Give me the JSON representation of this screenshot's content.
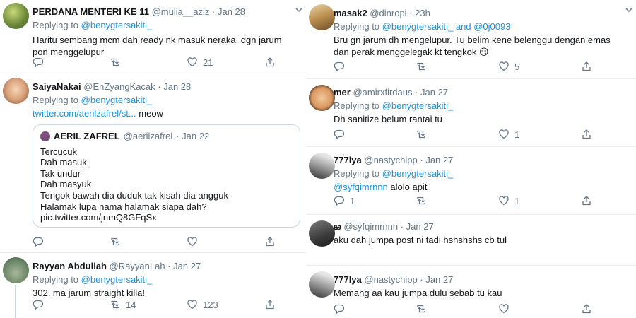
{
  "left": {
    "tweets": [
      {
        "name": "PERDANA MENTERI KE 11",
        "handle": "@mulia__aziz",
        "date": "· Jan 28",
        "replying_prefix": "Replying to ",
        "replying_to": "@benygtersakiti_",
        "text": "Haritu sembang mcm dah ready nk masuk neraka, dgn jarum pon menggelupur",
        "reply_count": "",
        "retweet_count": "",
        "like_count": "21"
      },
      {
        "name": "SaiyaNakai",
        "handle": "@EnZyangKacak",
        "date": "· Jan 28",
        "replying_prefix": "Replying to ",
        "replying_to": "@benygtersakiti_",
        "link": "twitter.com/aerilzafrel/st...",
        "text_after_link": " meow",
        "quote": {
          "name": "AERIL ZAFREL",
          "handle": "@aerilzafrel",
          "date": "· Jan 22",
          "lines": [
            "Tercucuk",
            "Dah masuk",
            "Tak undur",
            "Dah masyuk",
            "Tengok bawah dia duduk tak kisah dia angguk",
            "Halamak lupa nama halamak siapa dah?",
            "pic.twitter.com/jnmQ8GFqSx"
          ]
        }
      },
      {
        "name": "Rayyan Abdullah",
        "handle": "@RayyanLah",
        "date": "· Jan 27",
        "replying_prefix": "Replying to ",
        "replying_to": "@benygtersakiti_",
        "text": "302, ma jarum straight killa!",
        "reply_count": "",
        "retweet_count": "14",
        "like_count": "123"
      }
    ]
  },
  "right": {
    "tweets": [
      {
        "name": "masak2",
        "handle": "@dinropi",
        "date": "· 23h",
        "replying_prefix": "Replying to ",
        "replying_to": "@benygtersakiti_ and @0j0093",
        "text": "Bru gn jarum dh mengelupur. Tu belim kene belenggu dengan emas dan perak menggelegak kt tengkok 😏",
        "reply_count": "",
        "retweet_count": "",
        "like_count": "5"
      },
      {
        "name": "mer",
        "handle": "@amirxfirdaus",
        "date": "· Jan 27",
        "replying_prefix": "Replying to ",
        "replying_to": "@benygtersakiti_",
        "text": "Dh sanitize belum rantai tu",
        "reply_count": "",
        "retweet_count": "",
        "like_count": "1"
      },
      {
        "name": "777lya",
        "handle": "@nastychipp",
        "date": "· Jan 27",
        "replying_prefix": "Replying to ",
        "replying_to": "@benygtersakiti_",
        "mention": "@syfqimrnnn",
        "text_after_mention": " alolo apit",
        "reply_count": "1",
        "retweet_count": "",
        "like_count": "1"
      },
      {
        "name": "ఱ",
        "handle": "@syfqimrnnn",
        "date": "· Jan 27",
        "text": "aku dah jumpa post ni tadi hshshshs cb tul"
      },
      {
        "name": "777lya",
        "handle": "@nastychipp",
        "date": "· Jan 27",
        "text": "Memang aa kau jumpa dulu sebab tu kau"
      }
    ]
  },
  "icons": {
    "reply": "reply-icon",
    "retweet": "retweet-icon",
    "like": "like-icon",
    "share": "share-icon",
    "chevron": "chevron-down-icon"
  },
  "colors": {
    "link": "#1b95e0",
    "muted": "#657786",
    "border": "#e6ecf0"
  }
}
